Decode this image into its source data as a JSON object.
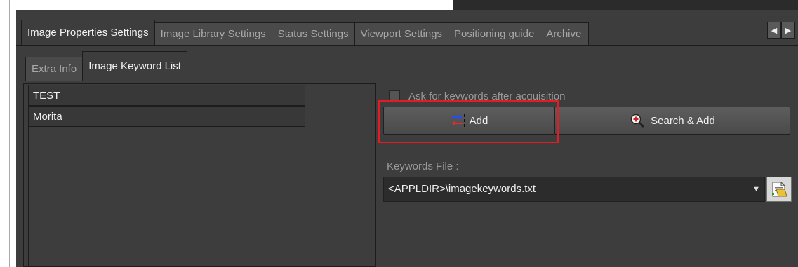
{
  "tabs_main": [
    {
      "label": "Image Properties Settings",
      "active": true
    },
    {
      "label": "Image Library Settings",
      "active": false
    },
    {
      "label": "Status Settings",
      "active": false
    },
    {
      "label": "Viewport Settings",
      "active": false
    },
    {
      "label": "Positioning guide",
      "active": false
    },
    {
      "label": "Archive",
      "active": false
    }
  ],
  "tab_scroll": {
    "left_icon": "triangle-left-icon",
    "right_icon": "triangle-right-icon"
  },
  "tabs_sub": [
    {
      "label": "Extra Info",
      "active": false
    },
    {
      "label": "Image Keyword List",
      "active": true
    }
  ],
  "keywords": [
    "TEST",
    "Morita"
  ],
  "options": {
    "ask_keywords_label": "Ask for keywords after acquisition",
    "ask_keywords_checked": false
  },
  "buttons": {
    "add_label": "Add",
    "add_icon": "add-keyword-icon",
    "search_add_label": "Search & Add",
    "search_add_icon": "magnifier-plus-icon"
  },
  "keywords_file": {
    "label": "Keywords File :",
    "value": "<APPLDIR>\\imagekeywords.txt",
    "browse_icon": "browse-file-icon"
  },
  "colors": {
    "panel_bg": "#3d3d3d",
    "highlight": "#e31b23"
  }
}
